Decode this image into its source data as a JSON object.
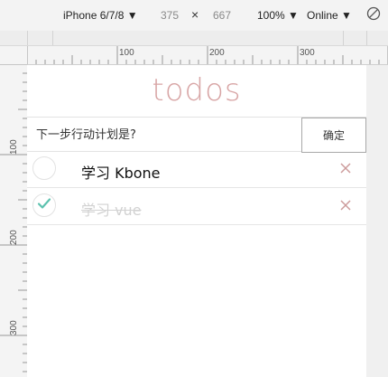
{
  "toolbar": {
    "device": "iPhone 6/7/8 ▼",
    "width": "375",
    "times": "×",
    "height": "667",
    "zoom": "100% ▼",
    "network": "Online ▼",
    "rotate_icon": "rotate-icon"
  },
  "rulers": {
    "top_labels": [
      "100",
      "200",
      "300"
    ],
    "left_labels": [
      "100",
      "200",
      "300"
    ]
  },
  "app": {
    "title": "todos",
    "new_todo": {
      "placeholder": "下一步行动计划是?",
      "value": "",
      "confirm_label": "确定"
    },
    "todos": [
      {
        "title": "学习 Kbone",
        "completed": false
      },
      {
        "title": "学习 vue",
        "completed": true
      }
    ]
  },
  "colors": {
    "title": "#d8a5a5",
    "check": "#5dc2af",
    "destroy": "#cc9a9a"
  }
}
